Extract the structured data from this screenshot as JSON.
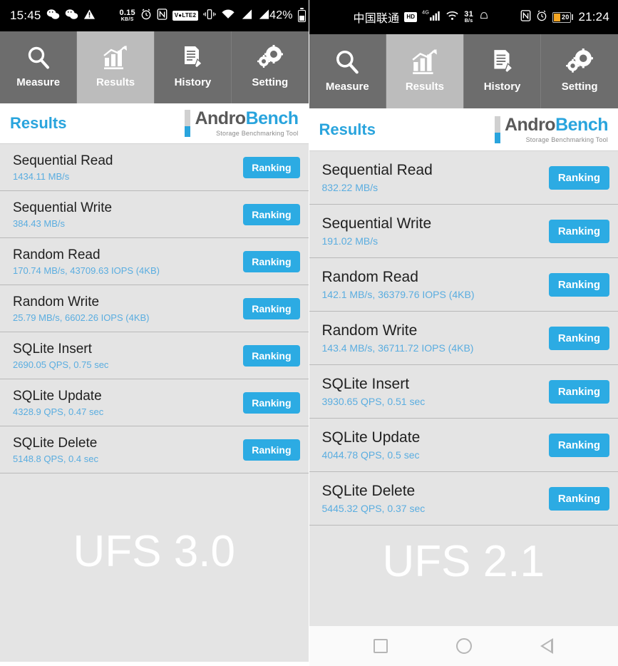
{
  "left_phone": {
    "statusbar": {
      "time": "15:45",
      "icons_left": [
        "wechat-icon",
        "wechat-icon",
        "warning-triangle-icon"
      ],
      "data_rate_value": "0.15",
      "data_rate_unit": "KB/S",
      "icons_mid": [
        "alarm-icon",
        "nfc-icon",
        "volte2-icon",
        "vibrate-icon",
        "wifi-icon",
        "signal-icon",
        "signal-icon"
      ],
      "battery_percent": "42%"
    },
    "tabs": [
      {
        "label": "Measure",
        "icon": "search-icon",
        "active": false
      },
      {
        "label": "Results",
        "icon": "bar-chart-icon",
        "active": true
      },
      {
        "label": "History",
        "icon": "document-pencil-icon",
        "active": false
      },
      {
        "label": "Setting",
        "icon": "gears-icon",
        "active": false
      }
    ],
    "header": {
      "title": "Results",
      "logo_first": "Andro",
      "logo_second": "Bench",
      "logo_subtitle": "Storage Benchmarking Tool"
    },
    "rows": [
      {
        "label": "Sequential Read",
        "value": "1434.11 MB/s",
        "button": "Ranking"
      },
      {
        "label": "Sequential Write",
        "value": "384.43 MB/s",
        "button": "Ranking"
      },
      {
        "label": "Random Read",
        "value": "170.74 MB/s, 43709.63 IOPS (4KB)",
        "button": "Ranking"
      },
      {
        "label": "Random Write",
        "value": "25.79 MB/s, 6602.26 IOPS (4KB)",
        "button": "Ranking"
      },
      {
        "label": "SQLite Insert",
        "value": "2690.05 QPS, 0.75 sec",
        "button": "Ranking"
      },
      {
        "label": "SQLite Update",
        "value": "4328.9 QPS, 0.47 sec",
        "button": "Ranking"
      },
      {
        "label": "SQLite Delete",
        "value": "5148.8 QPS, 0.4 sec",
        "button": "Ranking"
      }
    ],
    "watermark": "UFS 3.0"
  },
  "right_phone": {
    "statusbar": {
      "carrier": "中国联通",
      "hd_label": "HD",
      "network": "4G",
      "data_rate_value": "31",
      "data_rate_unit": "B/s",
      "icons_mid": [
        "signal-icon",
        "wifi-icon",
        "bell-icon"
      ],
      "icons_right": [
        "nfc-icon",
        "alarm-icon"
      ],
      "battery_percent": "20",
      "time": "21:24"
    },
    "tabs": [
      {
        "label": "Measure",
        "icon": "search-icon",
        "active": false
      },
      {
        "label": "Results",
        "icon": "bar-chart-icon",
        "active": true
      },
      {
        "label": "History",
        "icon": "document-pencil-icon",
        "active": false
      },
      {
        "label": "Setting",
        "icon": "gears-icon",
        "active": false
      }
    ],
    "header": {
      "title": "Results",
      "logo_first": "Andro",
      "logo_second": "Bench",
      "logo_subtitle": "Storage Benchmarking Tool"
    },
    "rows": [
      {
        "label": "Sequential Read",
        "value": "832.22 MB/s",
        "button": "Ranking"
      },
      {
        "label": "Sequential Write",
        "value": "191.02 MB/s",
        "button": "Ranking"
      },
      {
        "label": "Random Read",
        "value": "142.1 MB/s, 36379.76 IOPS (4KB)",
        "button": "Ranking"
      },
      {
        "label": "Random Write",
        "value": "143.4 MB/s, 36711.72 IOPS (4KB)",
        "button": "Ranking"
      },
      {
        "label": "SQLite Insert",
        "value": "3930.65 QPS, 0.51 sec",
        "button": "Ranking"
      },
      {
        "label": "SQLite Update",
        "value": "4044.78 QPS, 0.5 sec",
        "button": "Ranking"
      },
      {
        "label": "SQLite Delete",
        "value": "5445.32 QPS, 0.37 sec",
        "button": "Ranking"
      }
    ],
    "watermark": "UFS 2.1",
    "navbar": [
      "recents-square-icon",
      "home-circle-icon",
      "back-triangle-icon"
    ]
  },
  "colors": {
    "accent_blue": "#2cabe3",
    "value_blue": "#5aade0",
    "tab_bar": "#6d6d6d",
    "tab_active": "#bcbcbc",
    "list_bg": "#e4e4e4",
    "logo_gray": "#595959"
  }
}
